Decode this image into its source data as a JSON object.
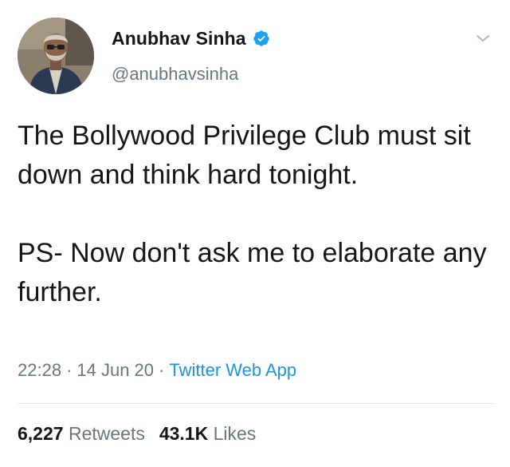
{
  "author": {
    "display_name": "Anubhav Sinha",
    "handle": "@anubhavsinha",
    "verified": true,
    "avatar_icon": "profile-photo"
  },
  "tweet": {
    "paragraphs": [
      "The Bollywood Privilege Club must sit down and think hard tonight.",
      "PS- Now don't ask me to elaborate any further."
    ],
    "time": "22:28",
    "date": "14 Jun 20",
    "source": "Twitter Web App",
    "separator": "·"
  },
  "stats": {
    "retweets_count": "6,227",
    "retweets_label": "Retweets",
    "likes_count": "43.1K",
    "likes_label": "Likes"
  },
  "colors": {
    "text": "#14171a",
    "secondary": "#657786",
    "link": "#1b95e0",
    "verified_badge": "#1da1f2",
    "divider": "#e1e8ed"
  },
  "icons": {
    "verified": "verified-badge-icon",
    "menu": "chevron-down-icon"
  }
}
